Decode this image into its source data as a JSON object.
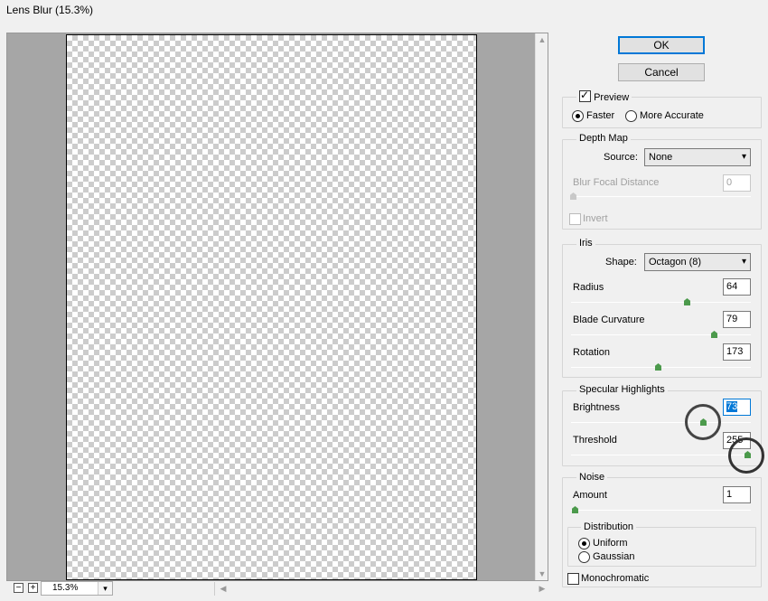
{
  "window": {
    "title": "Lens Blur (15.3%)"
  },
  "preview": {
    "zoom_value": "15.3%",
    "zoom_out_symbol": "−",
    "zoom_in_symbol": "+"
  },
  "buttons": {
    "ok": "OK",
    "cancel": "Cancel"
  },
  "preview_opts": {
    "preview_label": "Preview",
    "preview_checked": true,
    "faster": "Faster",
    "more_accurate": "More Accurate",
    "selected": "Faster"
  },
  "depth_map": {
    "label": "Depth Map",
    "source_label": "Source:",
    "source_value": "None",
    "blur_focal_distance_label": "Blur Focal Distance",
    "blur_focal_distance_value": "0",
    "invert_label": "Invert"
  },
  "iris": {
    "label": "Iris",
    "shape_label": "Shape:",
    "shape_value": "Octagon (8)",
    "radius_label": "Radius",
    "radius_value": "64",
    "blade_label": "Blade Curvature",
    "blade_value": "79",
    "rotation_label": "Rotation",
    "rotation_value": "173"
  },
  "specular": {
    "label": "Specular Highlights",
    "brightness_label": "Brightness",
    "brightness_value": "73",
    "threshold_label": "Threshold",
    "threshold_value": "255"
  },
  "noise": {
    "label": "Noise",
    "amount_label": "Amount",
    "amount_value": "1",
    "distribution_label": "Distribution",
    "uniform": "Uniform",
    "gaussian": "Gaussian",
    "selected": "Uniform",
    "monochromatic_label": "Monochromatic"
  },
  "icons": {
    "dropdown": "▾",
    "check": "✓",
    "scroll_up": "▲",
    "scroll_down": "▼",
    "scroll_left": "◀",
    "scroll_right": "▶"
  }
}
